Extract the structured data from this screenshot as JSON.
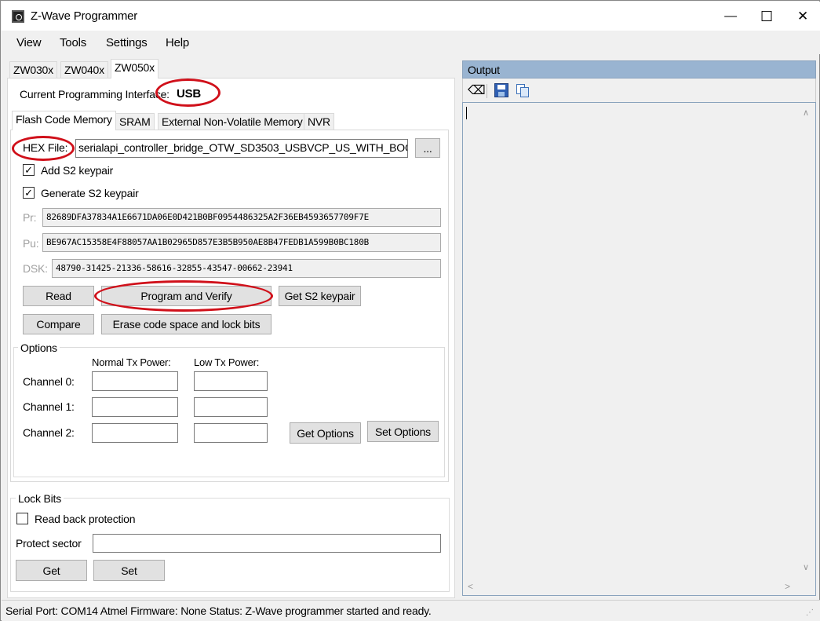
{
  "window": {
    "title": "Z-Wave Programmer",
    "min": "—",
    "max": "☐",
    "close": "✕"
  },
  "menu": [
    "View",
    "Tools",
    "Settings",
    "Help"
  ],
  "chip_tabs": [
    "ZW030x",
    "ZW040x",
    "ZW050x"
  ],
  "interface": {
    "label": "Current Programming Interface:",
    "value": "USB"
  },
  "mem_tabs": [
    "Flash Code Memory",
    "SRAM",
    "External Non-Volatile Memory",
    "NVR"
  ],
  "flash": {
    "hex_label": "HEX File:",
    "hex_value": "serialapi_controller_bridge_OTW_SD3503_USBVCP_US_WITH_BOO",
    "browse": "...",
    "add_s2": "Add S2 keypair",
    "gen_s2": "Generate S2 keypair",
    "pr_label": "Pr:",
    "pr_value": "82689DFA37834A1E6671DA06E0D421B0BF0954486325A2F36EB4593657709F7E",
    "pu_label": "Pu:",
    "pu_value": "BE967AC15358E4F88057AA1B02965D857E3B5B950AE8B47FEDB1A599B0BC180B",
    "dsk_label": "DSK:",
    "dsk_value": "48790-31425-21336-58616-32855-43547-00662-23941",
    "read": "Read",
    "program_verify": "Program and Verify",
    "get_s2": "Get S2 keypair",
    "compare": "Compare",
    "erase": "Erase code space and lock bits"
  },
  "options": {
    "title": "Options",
    "normal_tx": "Normal Tx Power:",
    "low_tx": "Low Tx Power:",
    "channels": [
      "Channel 0:",
      "Channel 1:",
      "Channel 2:"
    ],
    "get": "Get Options",
    "set": "Set Options"
  },
  "lockbits": {
    "title": "Lock Bits",
    "read_back": "Read back protection",
    "protect_sector": "Protect sector",
    "get": "Get",
    "set": "Set"
  },
  "output": {
    "title": "Output"
  },
  "status": {
    "text": "Serial Port: COM14  Atmel Firmware: None  Status: Z-Wave programmer started and ready."
  }
}
